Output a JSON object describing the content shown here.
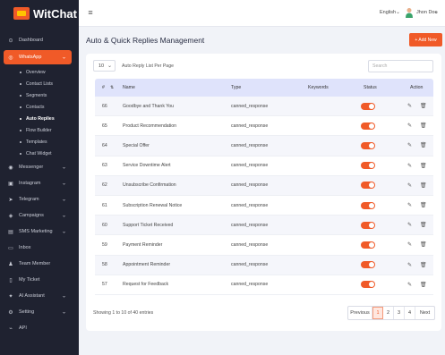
{
  "brand": {
    "name": "WitChat"
  },
  "sidebar": {
    "items": [
      {
        "label": "Dashboard",
        "icon": "dashboard-icon",
        "chevron": false
      },
      {
        "label": "WhatsApp",
        "icon": "whatsapp-icon",
        "chevron": true,
        "active": true
      },
      {
        "label": "Messenger",
        "icon": "messenger-icon",
        "chevron": true
      },
      {
        "label": "Instagram",
        "icon": "instagram-icon",
        "chevron": true
      },
      {
        "label": "Telegram",
        "icon": "telegram-icon",
        "chevron": true
      },
      {
        "label": "Campaigns",
        "icon": "campaign-icon",
        "chevron": true
      },
      {
        "label": "SMS Marketing",
        "icon": "sms-icon",
        "chevron": true
      },
      {
        "label": "Inbox",
        "icon": "inbox-icon",
        "chevron": false
      },
      {
        "label": "Team Member",
        "icon": "team-icon",
        "chevron": false
      },
      {
        "label": "My Ticket",
        "icon": "ticket-icon",
        "chevron": false
      },
      {
        "label": "AI Assistant",
        "icon": "ai-icon",
        "chevron": true
      },
      {
        "label": "Setting",
        "icon": "gear-icon",
        "chevron": true
      },
      {
        "label": "API",
        "icon": "api-icon",
        "chevron": false
      }
    ],
    "whatsapp_sub": [
      {
        "label": "Overview"
      },
      {
        "label": "Contact Lists"
      },
      {
        "label": "Segments"
      },
      {
        "label": "Contacts"
      },
      {
        "label": "Auto Replies",
        "current": true
      },
      {
        "label": "Flow Builder"
      },
      {
        "label": "Templates"
      },
      {
        "label": "Chat Widget"
      }
    ]
  },
  "topbar": {
    "language": "English",
    "user": "Jhon Doe"
  },
  "page": {
    "title": "Auto & Quick Replies Management",
    "add_button": "+ Add New"
  },
  "table_controls": {
    "per_page": "10",
    "per_page_label": "Auto Reply List Per Page",
    "search_placeholder": "Search"
  },
  "table": {
    "headers": {
      "num": "#",
      "name": "Name",
      "type": "Type",
      "keywords": "Keywords",
      "status": "Status",
      "action": "Action"
    },
    "rows": [
      {
        "id": "66",
        "name": "Goodbye and Thank You",
        "type": "canned_response",
        "keywords": "",
        "status": true
      },
      {
        "id": "65",
        "name": "Product Recommendation",
        "type": "canned_response",
        "keywords": "",
        "status": true
      },
      {
        "id": "64",
        "name": "Special Offer",
        "type": "canned_response",
        "keywords": "",
        "status": true
      },
      {
        "id": "63",
        "name": "Service Downtime Alert",
        "type": "canned_response",
        "keywords": "",
        "status": true
      },
      {
        "id": "62",
        "name": "Unsubscribe Confirmation",
        "type": "canned_response",
        "keywords": "",
        "status": true
      },
      {
        "id": "61",
        "name": "Subscription Renewal Notice",
        "type": "canned_response",
        "keywords": "",
        "status": true
      },
      {
        "id": "60",
        "name": "Support Ticket Received",
        "type": "canned_response",
        "keywords": "",
        "status": true
      },
      {
        "id": "59",
        "name": "Payment Reminder",
        "type": "canned_response",
        "keywords": "",
        "status": true
      },
      {
        "id": "58",
        "name": "Appointment Reminder",
        "type": "canned_response",
        "keywords": "",
        "status": true
      },
      {
        "id": "57",
        "name": "Request for Feedback",
        "type": "canned_response",
        "keywords": "",
        "status": true
      }
    ]
  },
  "footer": {
    "info": "Showing 1 to 10 of 40 entries"
  },
  "pagination": {
    "prev": "Previous",
    "pages": [
      "1",
      "2",
      "3",
      "4"
    ],
    "current": "1",
    "next": "Next"
  },
  "colors": {
    "accent": "#f05a28",
    "sidebar_bg": "#1f2230",
    "table_header": "#dfe3fb"
  }
}
